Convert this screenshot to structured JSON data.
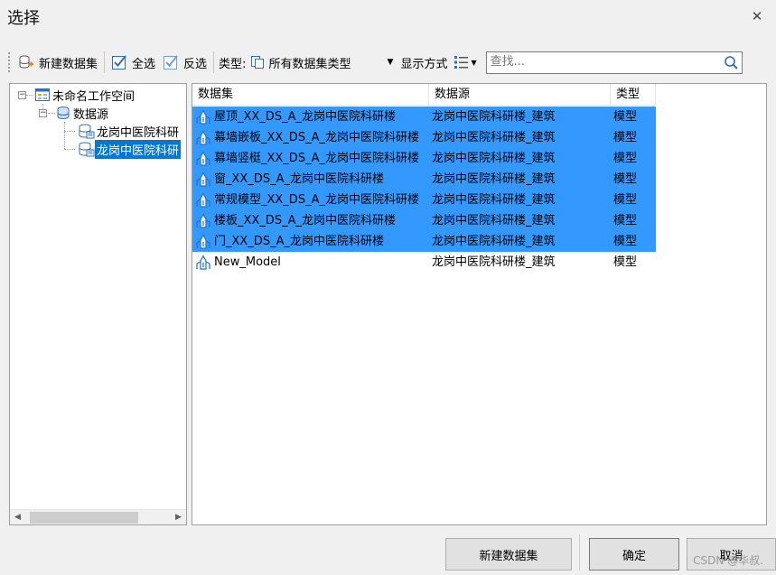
{
  "window": {
    "title": "选择"
  },
  "toolbar": {
    "new_dataset_label": "新建数据集",
    "select_all_label": "全选",
    "invert_label": "反选",
    "type_label": "类型:",
    "type_value": "所有数据集类型",
    "display_mode_label": "显示方式",
    "search_placeholder": "查找..."
  },
  "tree": {
    "workspace": "未命名工作空间",
    "datasources_group": "数据源",
    "items": [
      "龙岗中医院科研",
      "龙岗中医院科研"
    ]
  },
  "list": {
    "columns": [
      "数据集",
      "数据源",
      "类型"
    ],
    "rows": [
      {
        "name": "屋顶_XX_DS_A_龙岗中医院科研楼",
        "source": "龙岗中医院科研楼_建筑",
        "type": "模型",
        "selected": true
      },
      {
        "name": "幕墙嵌板_XX_DS_A_龙岗中医院科研楼",
        "source": "龙岗中医院科研楼_建筑",
        "type": "模型",
        "selected": true
      },
      {
        "name": "幕墙竖梃_XX_DS_A_龙岗中医院科研楼",
        "source": "龙岗中医院科研楼_建筑",
        "type": "模型",
        "selected": true
      },
      {
        "name": "窗_XX_DS_A_龙岗中医院科研楼",
        "source": "龙岗中医院科研楼_建筑",
        "type": "模型",
        "selected": true
      },
      {
        "name": "常规模型_XX_DS_A_龙岗中医院科研楼",
        "source": "龙岗中医院科研楼_建筑",
        "type": "模型",
        "selected": true
      },
      {
        "name": "楼板_XX_DS_A_龙岗中医院科研楼",
        "source": "龙岗中医院科研楼_建筑",
        "type": "模型",
        "selected": true
      },
      {
        "name": "门_XX_DS_A_龙岗中医院科研楼",
        "source": "龙岗中医院科研楼_建筑",
        "type": "模型",
        "selected": true
      },
      {
        "name": "New_Model",
        "source": "龙岗中医院科研楼_建筑",
        "type": "模型",
        "selected": false
      }
    ]
  },
  "footer": {
    "new_dataset_button": "新建数据集",
    "ok_button": "确定",
    "cancel_button": "取消",
    "watermark": "CSDN @华叔."
  },
  "colors": {
    "selection": "#3399ff",
    "tree_selection": "#0078d7",
    "icon_blue": "#1e6fd0"
  }
}
